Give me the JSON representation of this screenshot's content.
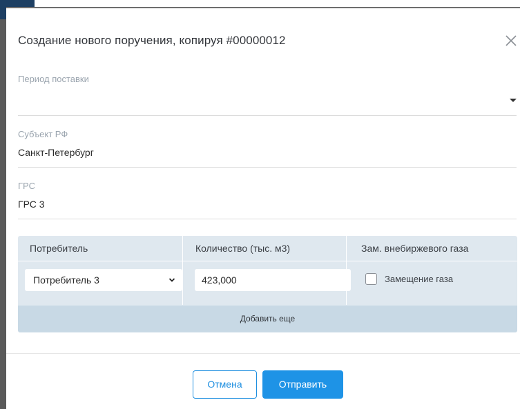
{
  "modal": {
    "title": "Создание нового поручения, копируя #00000012",
    "close_icon": "close-icon"
  },
  "fields": {
    "period": {
      "label": "Период поставки",
      "value": ""
    },
    "subject": {
      "label": "Субъект РФ",
      "value": "Санкт-Петербург"
    },
    "grs": {
      "label": "ГРС",
      "value": "ГРС 3"
    }
  },
  "table": {
    "headers": [
      "Потребитель",
      "Количество (тыс. м3)",
      "Зам. внебиржевого газа"
    ],
    "rows": [
      {
        "consumer": "Потребитель 3",
        "quantity": "423,000",
        "replacement_checked": false,
        "replacement_label": "Замещение газа"
      }
    ],
    "add_more_label": "Добавить еще"
  },
  "footer": {
    "cancel_label": "Отмена",
    "submit_label": "Отправить"
  },
  "colors": {
    "accent": "#1e93e6",
    "table_bg": "#dfe8ef",
    "add_more_bg": "#c8d9e5"
  }
}
